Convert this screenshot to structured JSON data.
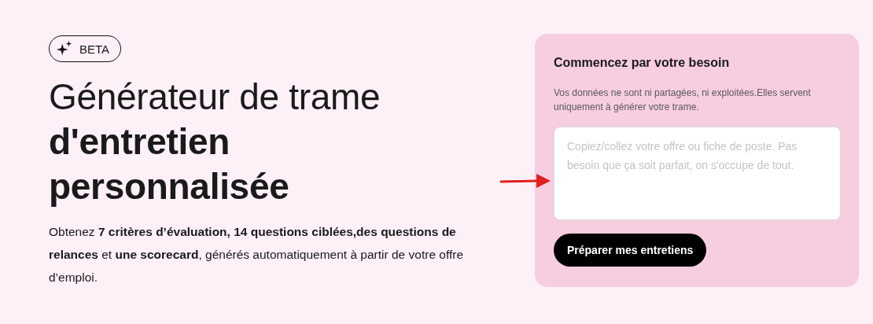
{
  "badge": {
    "label": "BETA"
  },
  "heading": "Générateur de trame **d'entretien personnalisée**",
  "description": "Obtenez **7 critères d’évaluation, 14 questions ciblées,des questions de relances** et **une scorecard**, générés automatiquement à partir de votre offre d’emploi.",
  "form": {
    "title": "Commencez par votre besoin",
    "note": "Vos données ne sont ni partagées, ni exploitées.Elles servent uniquement à générer votre trame.",
    "job_field": {
      "placeholder": "Copiez/collez votre offre ou fiche de poste. Pas besoin que ça soit parfait, on s'occupe de tout."
    },
    "submit_button": "Préparer mes entretiens"
  }
}
